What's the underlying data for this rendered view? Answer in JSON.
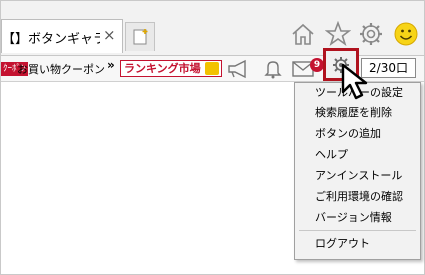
{
  "tab": {
    "title": "【】ボタンギャラリー",
    "close": "×"
  },
  "toolbar": {
    "badge": "ｸｰﾎﾟﾝ",
    "coupon_label": "お買い物クーポン",
    "chevron": "»",
    "ranking_label": "ランキング市場",
    "mail_count": "9",
    "page_indicator": "2/30口"
  },
  "icons": {
    "home": "home-icon",
    "star": "star-icon",
    "settings": "gear-icon",
    "smiley": "smiley-icon",
    "megaphone": "megaphone-icon",
    "bell": "bell-icon",
    "mail": "mail-icon"
  },
  "menu": {
    "items": [
      "ツールバーの設定",
      "検索履歴を削除",
      "ボタンの追加",
      "ヘルプ",
      "アンインストール",
      "ご利用環境の確認",
      "バージョン情報"
    ],
    "logout": "ログアウト"
  },
  "colors": {
    "accent": "#c41230",
    "highlight_border": "#b0121e",
    "smiley": "#f7d417"
  }
}
